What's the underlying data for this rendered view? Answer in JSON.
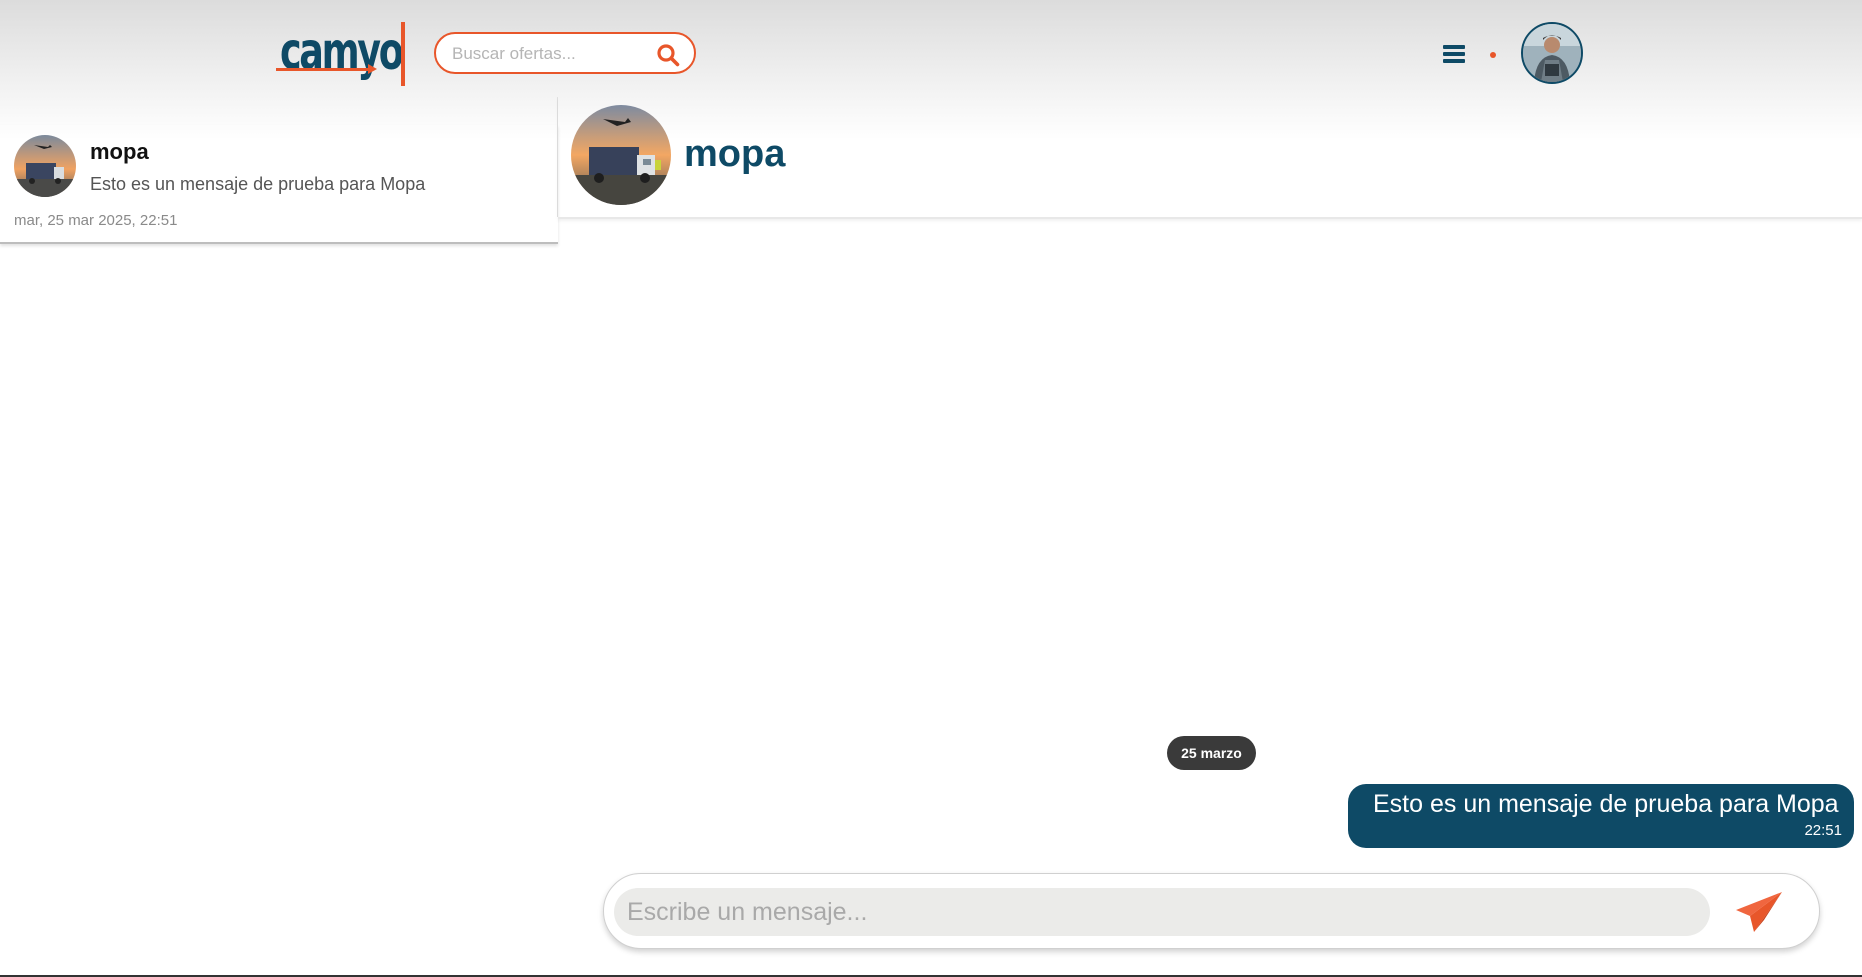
{
  "header": {
    "logo_text": "camyo",
    "search": {
      "placeholder": "Buscar ofertas...",
      "value": ""
    },
    "icons": {
      "search": "search-icon",
      "menu": "hamburger-menu-icon",
      "notification": "notification-dot-icon"
    }
  },
  "conversations": [
    {
      "name": "mopa",
      "last_message": "Esto es un mensaje de prueba para Mopa",
      "date": "mar, 25 mar 2025, 22:51"
    }
  ],
  "chat": {
    "contact_name": "mopa",
    "date_separator": "25 marzo",
    "messages": [
      {
        "text": "Esto es un mensaje de prueba para Mopa",
        "time": "22:51",
        "outgoing": true
      }
    ],
    "composer": {
      "placeholder": "Escribe un mensaje...",
      "value": ""
    }
  },
  "colors": {
    "brand_blue": "#0e4a66",
    "accent_orange": "#e8562a",
    "pill_dark": "#3a3a3a",
    "input_bg": "#ebebe9"
  }
}
